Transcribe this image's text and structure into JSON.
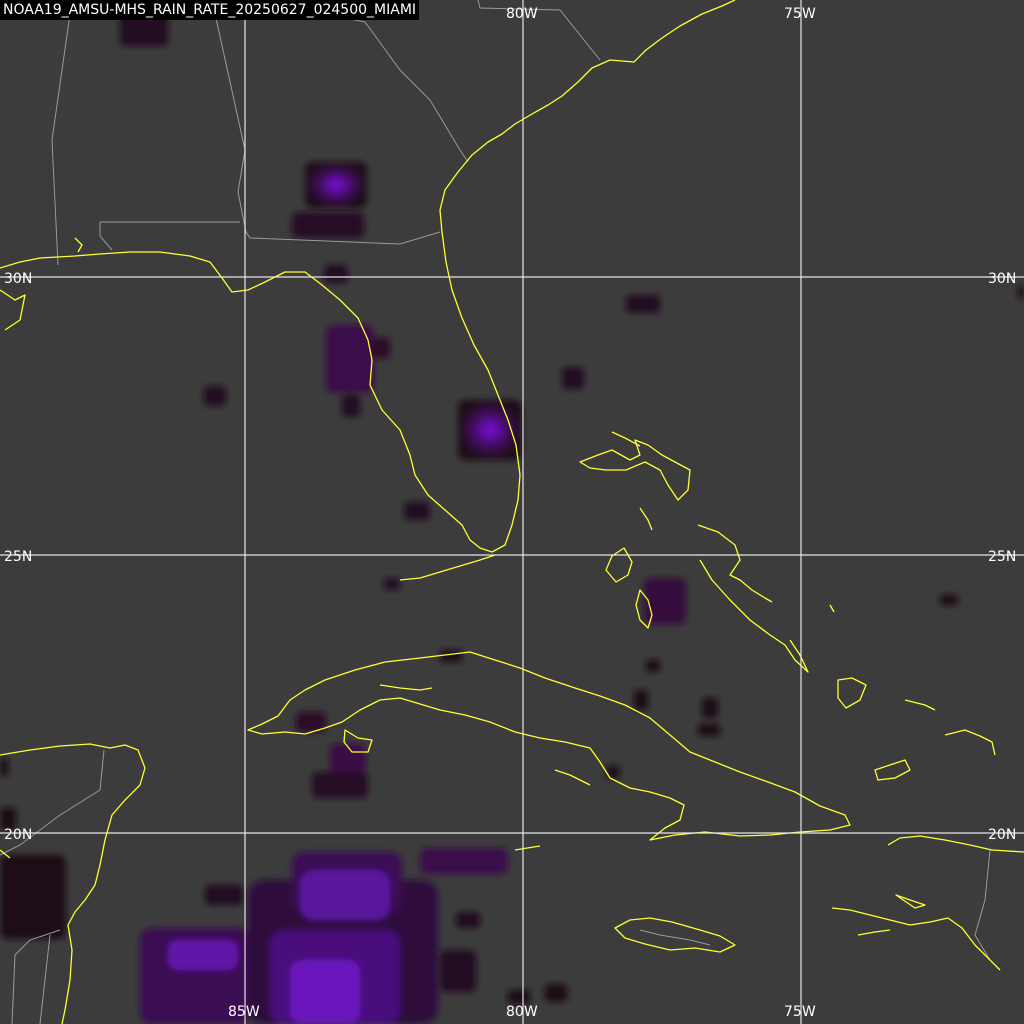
{
  "title": "NOAA19_AMSU-MHS_RAIN_RATE_20250627_024500_MIAMI",
  "colors": {
    "background": "#3c3c3c",
    "grid": "#e6e6e6",
    "coastline": "#ffff33",
    "borders": "#9a9a9a",
    "rain_low": "#2a0a24",
    "rain_high": "#7b10e0"
  },
  "grid_labels": {
    "lon": [
      "85W",
      "80W",
      "75W"
    ],
    "lat": [
      "30N",
      "25N",
      "20N"
    ]
  }
}
